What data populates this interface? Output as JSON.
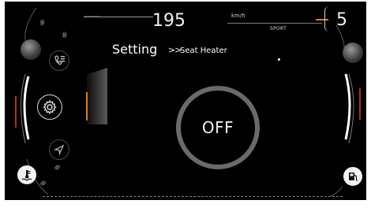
{
  "speed": {
    "value": "195",
    "unit": "km/h"
  },
  "drive_mode": "SPORT",
  "gear": "5",
  "header": {
    "title": "Setting",
    "separator": ">>",
    "subtitle": "Seat Heater"
  },
  "seat_heater": {
    "status": "OFF",
    "ring_color": "#6a6a6a"
  },
  "icons": {
    "left": [
      "music-phone-icon",
      "gear-icon",
      "navigation-icon",
      "coolant-temp-icon"
    ],
    "right": [
      "fuel-pump-icon"
    ]
  },
  "colors": {
    "background": "#000000",
    "accent": "#e07a1c",
    "text": "#ffffff"
  }
}
